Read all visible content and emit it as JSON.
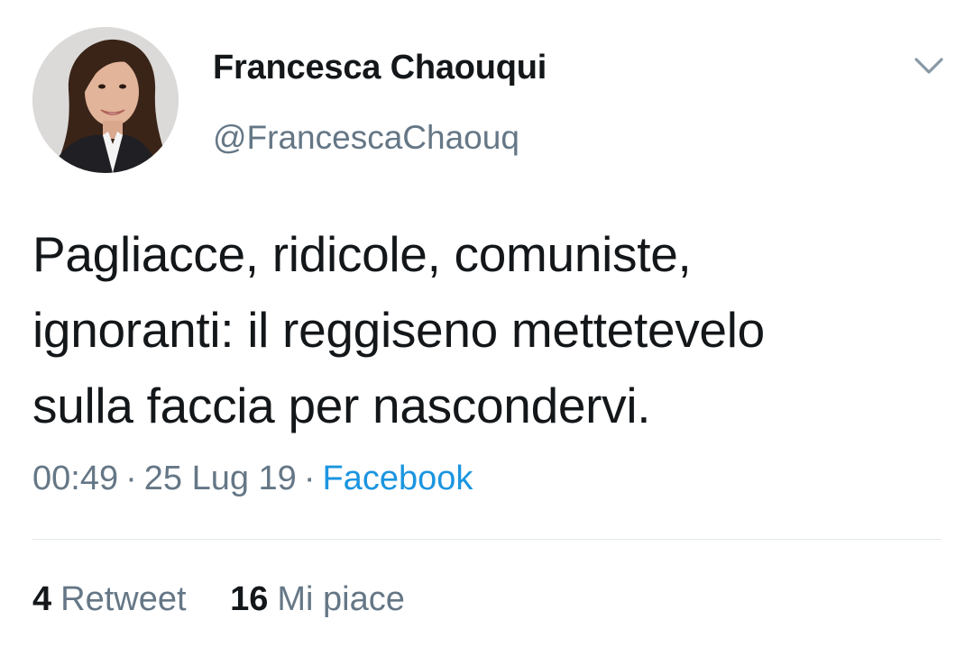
{
  "author": {
    "display_name": "Francesca Chaouqui",
    "handle": "@FrancescaChaouq"
  },
  "tweet": {
    "lines": [
      "Pagliacce, ridicole, comuniste,",
      "ignoranti: il reggiseno mettetevelo",
      "sulla faccia per nascondervi."
    ],
    "time": "00:49",
    "separator": "·",
    "date": "25 Lug 19",
    "source": "Facebook"
  },
  "stats": {
    "retweets_count": "4",
    "retweets_label": "Retweet",
    "likes_count": "16",
    "likes_label": "Mi piace"
  },
  "icons": {
    "menu": "chevron-down-icon"
  },
  "colors": {
    "text_primary": "#14171a",
    "text_secondary": "#657786",
    "link": "#1b95e0",
    "divider": "#e1e8ed"
  }
}
